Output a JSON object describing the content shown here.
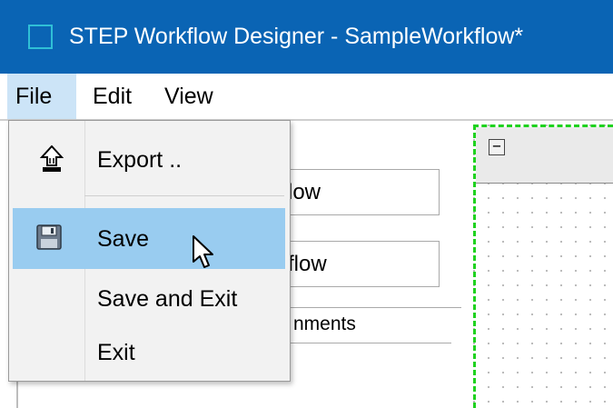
{
  "window": {
    "title": "STEP Workflow Designer - SampleWorkflow*",
    "icon": "app-window-icon"
  },
  "menubar": {
    "file": "File",
    "edit": "Edit",
    "view": "View"
  },
  "background": {
    "field1_value": "low",
    "field2_value": "flow",
    "tab_label": "nments",
    "collapse_symbol": "−"
  },
  "file_menu": {
    "items": [
      {
        "label": "Export ..",
        "icon": "export-icon"
      },
      {
        "label": "Save",
        "icon": "floppy-disk-icon",
        "highlighted": true
      },
      {
        "label": "Save and Exit"
      },
      {
        "label": "Exit"
      }
    ]
  },
  "colors": {
    "titlebar": "#0a64b4",
    "menu_active": "#cce4f7",
    "item_highlight": "#99ccf0",
    "canvas_selection": "#1fd21f"
  }
}
